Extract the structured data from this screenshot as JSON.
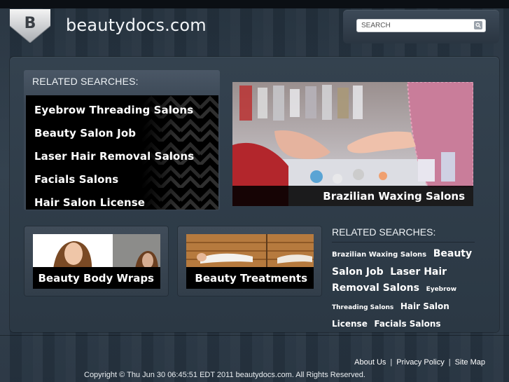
{
  "site": {
    "logo_letter": "B",
    "title": "beautydocs.com"
  },
  "search": {
    "placeholder": "SEARCH"
  },
  "related_left": {
    "heading": "RELATED SEARCHES:",
    "items": [
      "Eyebrow Threading Salons",
      "Beauty Salon Job",
      "Laser Hair Removal Salons",
      "Facials Salons",
      "Hair Salon License"
    ]
  },
  "feature": {
    "caption": "Brazilian Waxing Salons"
  },
  "cards": [
    {
      "caption": "Beauty Body Wraps"
    },
    {
      "caption": "Beauty Treatments"
    }
  ],
  "related_right": {
    "heading": "RELATED SEARCHES:",
    "tags": [
      {
        "text": "Brazilian Waxing Salons",
        "size": "s1"
      },
      {
        "text": "Beauty Salon Job",
        "size": "s2"
      },
      {
        "text": "Laser Hair Removal Salons",
        "size": "s2"
      },
      {
        "text": "Eyebrow Threading Salons",
        "size": "s0"
      },
      {
        "text": "Hair Salon License",
        "size": "s3"
      },
      {
        "text": "Facials Salons",
        "size": "s3"
      }
    ]
  },
  "footer": {
    "links": [
      "About Us",
      "Privacy Policy",
      "Site Map"
    ],
    "separator": "|",
    "copyright": "Copyright © Thu Jun 30 06:45:51 EDT 2011 beautydocs.com. All Rights Reserved."
  },
  "colors": {
    "background": "#2d3b49",
    "panel": "#34424f",
    "accent": "#000000",
    "text": "#ffffff"
  },
  "icons": {
    "search_button": "search-icon",
    "logo": "logo-shield-icon"
  }
}
